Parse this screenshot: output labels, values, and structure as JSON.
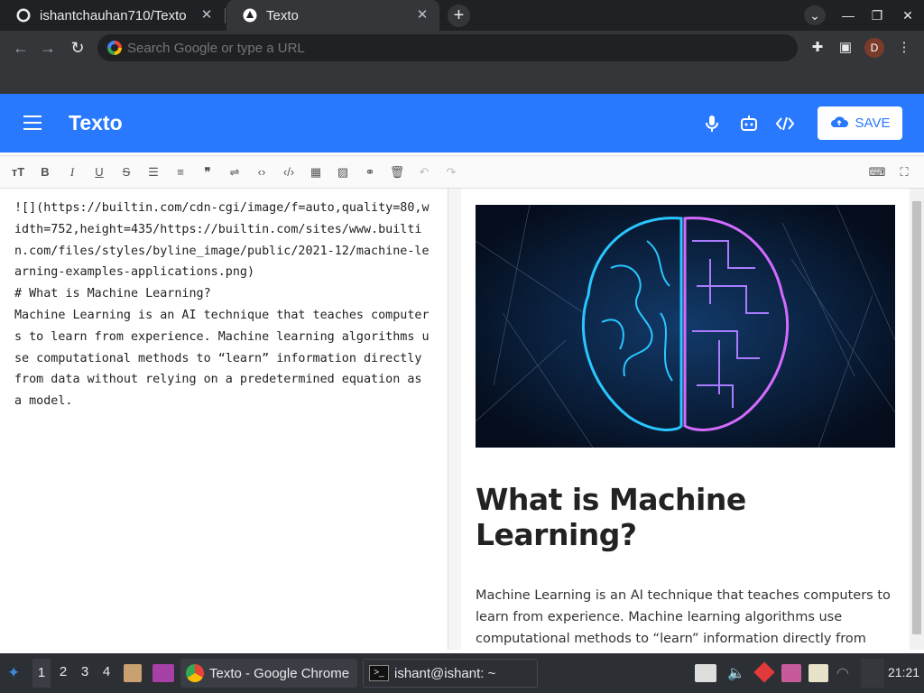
{
  "browser": {
    "tabs": [
      {
        "title": "ishantchauhan710/Texto"
      },
      {
        "title": "Texto"
      }
    ],
    "omnibox_placeholder": "Search Google or type a URL",
    "profile_initial": "D"
  },
  "app": {
    "title": "Texto",
    "save_label": "SAVE",
    "accent": "#2979ff"
  },
  "editor": {
    "content": "![](https://builtin.com/cdn-cgi/image/f=auto,quality=80,width=752,height=435/https://builtin.com/sites/www.builtin.com/files/styles/byline_image/public/2021-12/machine-learning-examples-applications.png)\n# What is Machine Learning?\nMachine Learning is an AI technique that teaches computers to learn from experience. Machine learning algorithms use computational methods to “learn” information directly from data without relying on a predetermined equation as a model."
  },
  "preview": {
    "heading": "What is Machine Learning?",
    "paragraph": "Machine Learning is an AI technique that teaches computers to learn from experience. Machine learning algorithms use computational methods to “learn” information directly from data without relying on a predetermined equation as a model."
  },
  "taskbar": {
    "workspaces": [
      "1",
      "2",
      "3",
      "4"
    ],
    "tasks": [
      {
        "label": "Texto - Google Chrome"
      },
      {
        "label": "ishant@ishant: ~"
      }
    ],
    "clock": "21:21"
  }
}
